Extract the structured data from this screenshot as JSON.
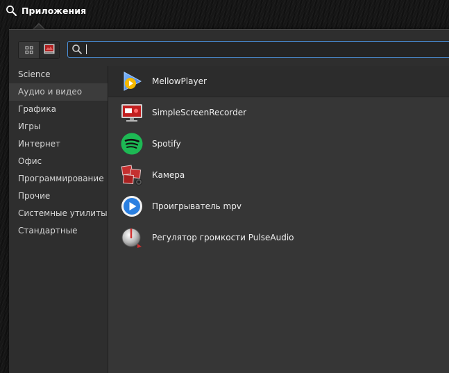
{
  "topbar": {
    "apps_button_label": "Приложения",
    "icon": "search-icon"
  },
  "toolbar": {
    "view_buttons": [
      {
        "name": "grid-view",
        "icon": "grid-icon",
        "active": false
      },
      {
        "name": "category-view",
        "icon": "category-icon",
        "active": true
      }
    ],
    "search": {
      "value": "",
      "placeholder": "",
      "icon": "search-icon"
    }
  },
  "categories": [
    {
      "label": "Science"
    },
    {
      "label": "Аудио и видео",
      "hover": true
    },
    {
      "label": "Графика"
    },
    {
      "label": "Игры"
    },
    {
      "label": "Интернет"
    },
    {
      "label": "Офис"
    },
    {
      "label": "Программирование"
    },
    {
      "label": "Прочие"
    },
    {
      "label": "Системные утилиты"
    },
    {
      "label": "Стандартные"
    }
  ],
  "apps": [
    {
      "label": "MellowPlayer",
      "icon": "mellowplayer-icon",
      "selected": true
    },
    {
      "label": "SimpleScreenRecorder",
      "icon": "screen-recorder-icon"
    },
    {
      "label": "Spotify",
      "icon": "spotify-icon"
    },
    {
      "label": "Камера",
      "icon": "camera-icon"
    },
    {
      "label": "Проигрыватель mpv",
      "icon": "mpv-player-icon"
    },
    {
      "label": "Регулятор громкости PulseAudio",
      "icon": "volume-control-icon"
    }
  ],
  "colors": {
    "accent": "#4a8fd8",
    "panel": "#2e2e2e",
    "apps_panel": "#363636",
    "spotify_green": "#1db954"
  }
}
